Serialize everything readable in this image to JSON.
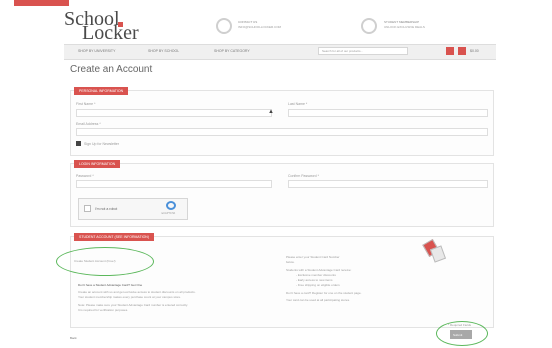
{
  "header": {
    "logo_line1": "School",
    "logo_line2": "Locker",
    "info1_title": "CONTACT US",
    "info1_text": "INFO@SCHOOLLOCKER.COM",
    "info2_title": "STUDENT MEMBERSHIP",
    "info2_text": "UNLOCK EXCLUSIVE DEALS"
  },
  "nav": {
    "items": [
      "SHOP BY UNIVERSITY",
      "SHOP BY SCHOOL",
      "SHOP BY CATEGORY"
    ],
    "search_placeholder": "Search for all of our products...",
    "cart_label": "$0.00"
  },
  "page": {
    "title": "Create an Account"
  },
  "personal": {
    "heading": "PERSONAL INFORMATION",
    "first_name_label": "First Name *",
    "last_name_label": "Last Name *",
    "email_label": "Email Address *",
    "newsletter_label": "Sign Up for Newsletter"
  },
  "login": {
    "heading": "LOGIN INFORMATION",
    "password_label": "Password *",
    "confirm_label": "Confirm Password *",
    "captcha_label": "I'm not a robot",
    "captcha_brand": "reCAPTCHA"
  },
  "student": {
    "heading": "STUDENT ACCOUNT (SEE INFORMATION)",
    "left_field_text": "Create Student Account (Free!)",
    "left_subtitle": "Don't have a Student Advantage Card? Get One",
    "left_p1": "Create an account with us and get exclusive access to student discounts on all products.",
    "left_p2": "Your student membership makes every purchase count at your campus store.",
    "left_p3": "Note: Please make sure your Student Advantage Card number is entered correctly.",
    "left_p4": "It is required for verification purposes.",
    "right_p1": "Please enter your Student Card Number",
    "right_p2": "below.",
    "right_l1": "Students with a Student Advantage Card receive:",
    "right_l2": "- Exclusive member discounts",
    "right_l3": "- Early access to new items",
    "right_l4": "- Free shipping on eligible orders",
    "right_p3": "Don't have a card? Register for one on the student page.",
    "right_p4": "Your card can be used at all participating stores."
  },
  "footer": {
    "back_label": "Back",
    "required_note": "* Required Fields",
    "submit_label": "Submit"
  },
  "colors": {
    "accent": "#d9534f",
    "highlight_oval": "#5cb85c"
  }
}
